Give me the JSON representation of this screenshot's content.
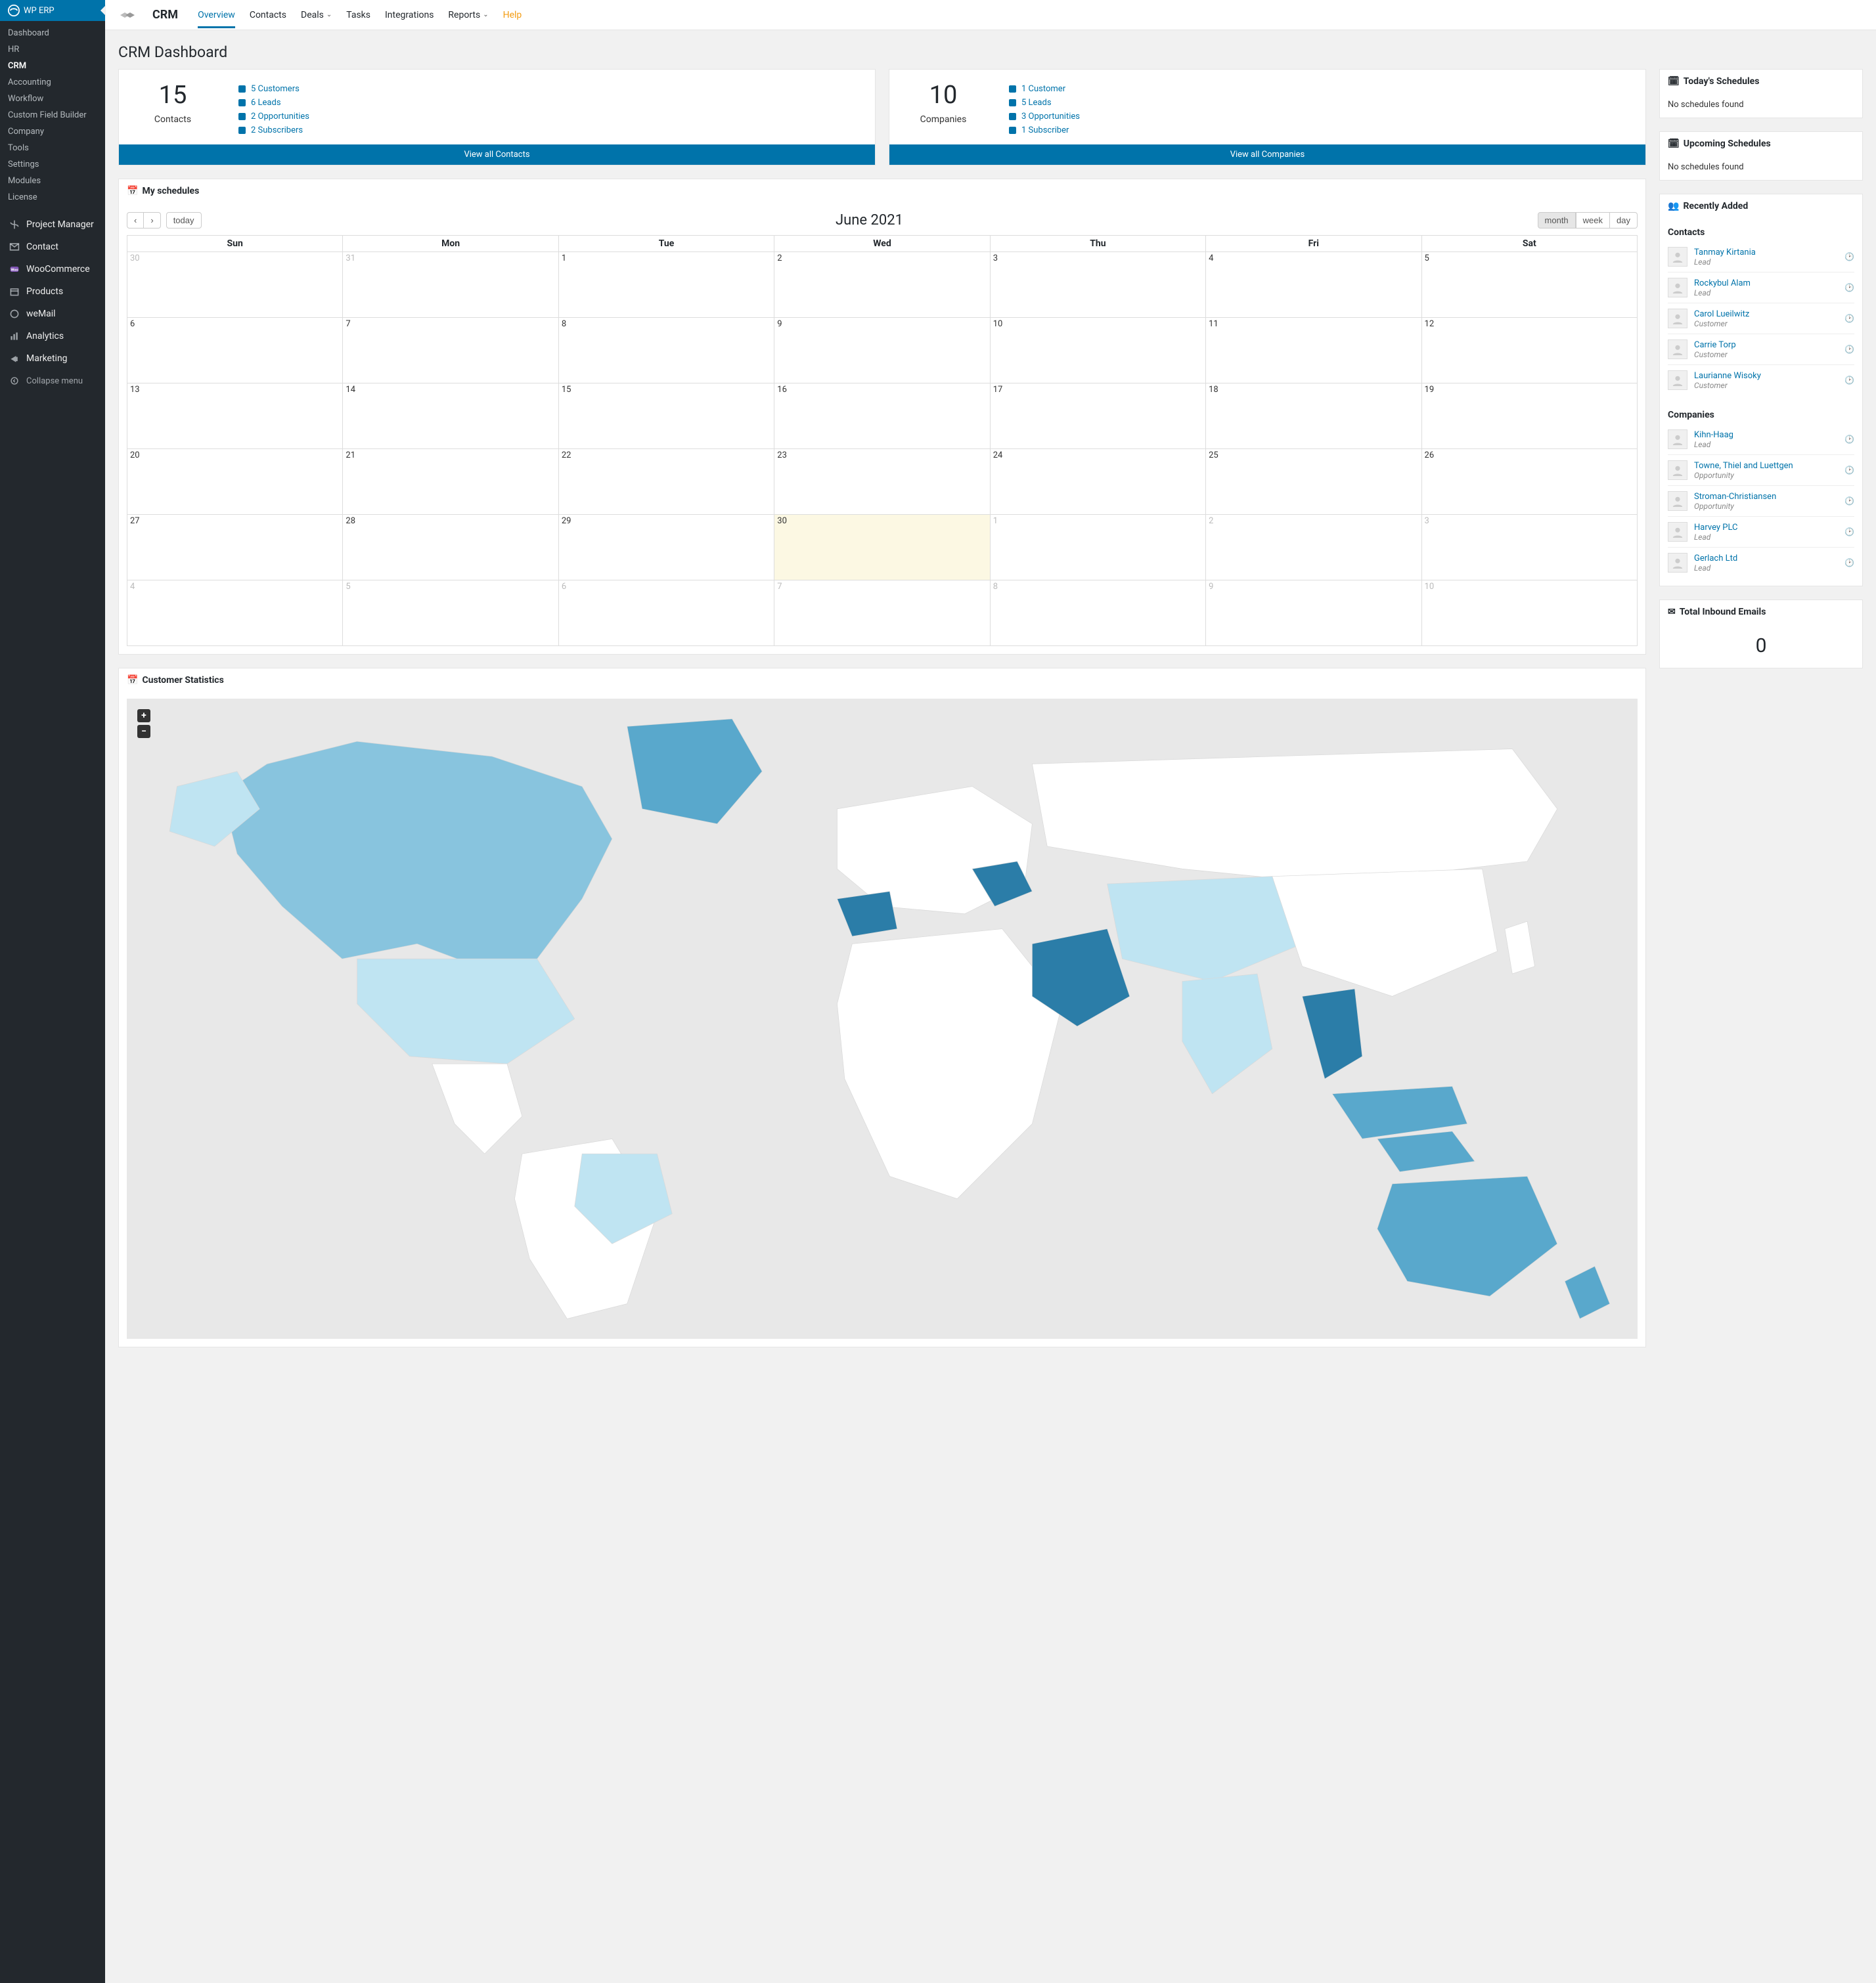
{
  "brand": "WP ERP",
  "admin_submenu": [
    {
      "label": "Dashboard",
      "active": false
    },
    {
      "label": "HR",
      "active": false
    },
    {
      "label": "CRM",
      "active": true
    },
    {
      "label": "Accounting",
      "active": false
    },
    {
      "label": "Workflow",
      "active": false
    },
    {
      "label": "Custom Field Builder",
      "active": false
    },
    {
      "label": "Company",
      "active": false
    },
    {
      "label": "Tools",
      "active": false
    },
    {
      "label": "Settings",
      "active": false
    },
    {
      "label": "Modules",
      "active": false
    },
    {
      "label": "License",
      "active": false
    }
  ],
  "admin_menu": [
    {
      "label": "Project Manager",
      "icon": "pm"
    },
    {
      "label": "Contact",
      "icon": "mail"
    },
    {
      "label": "WooCommerce",
      "icon": "woo"
    },
    {
      "label": "Products",
      "icon": "box"
    },
    {
      "label": "weMail",
      "icon": "wemail"
    },
    {
      "label": "Analytics",
      "icon": "bar"
    },
    {
      "label": "Marketing",
      "icon": "mega"
    }
  ],
  "collapse_label": "Collapse menu",
  "app_name": "CRM",
  "tabs": [
    {
      "label": "Overview",
      "active": true,
      "caret": false
    },
    {
      "label": "Contacts",
      "active": false,
      "caret": false
    },
    {
      "label": "Deals",
      "active": false,
      "caret": true
    },
    {
      "label": "Tasks",
      "active": false,
      "caret": false
    },
    {
      "label": "Integrations",
      "active": false,
      "caret": false
    },
    {
      "label": "Reports",
      "active": false,
      "caret": true
    },
    {
      "label": "Help",
      "active": false,
      "caret": false,
      "help": true
    }
  ],
  "page_title": "CRM Dashboard",
  "contacts_card": {
    "count": "15",
    "label": "Contacts",
    "items": [
      "5 Customers",
      "6 Leads",
      "2 Opportunities",
      "2 Subscribers"
    ],
    "footer": "View all Contacts"
  },
  "companies_card": {
    "count": "10",
    "label": "Companies",
    "items": [
      "1 Customer",
      "5 Leads",
      "3 Opportunities",
      "1 Subscriber"
    ],
    "footer": "View all Companies"
  },
  "schedules_title": "My schedules",
  "calendar": {
    "title": "June 2021",
    "today_btn": "today",
    "views": [
      {
        "l": "month",
        "a": true
      },
      {
        "l": "week",
        "a": false
      },
      {
        "l": "day",
        "a": false
      }
    ],
    "dow": [
      "Sun",
      "Mon",
      "Tue",
      "Wed",
      "Thu",
      "Fri",
      "Sat"
    ],
    "weeks": [
      [
        {
          "d": "30",
          "o": true
        },
        {
          "d": "31",
          "o": true
        },
        {
          "d": "1"
        },
        {
          "d": "2"
        },
        {
          "d": "3"
        },
        {
          "d": "4"
        },
        {
          "d": "5"
        }
      ],
      [
        {
          "d": "6"
        },
        {
          "d": "7"
        },
        {
          "d": "8"
        },
        {
          "d": "9"
        },
        {
          "d": "10"
        },
        {
          "d": "11"
        },
        {
          "d": "12"
        }
      ],
      [
        {
          "d": "13"
        },
        {
          "d": "14"
        },
        {
          "d": "15"
        },
        {
          "d": "16"
        },
        {
          "d": "17"
        },
        {
          "d": "18"
        },
        {
          "d": "19"
        }
      ],
      [
        {
          "d": "20"
        },
        {
          "d": "21"
        },
        {
          "d": "22"
        },
        {
          "d": "23"
        },
        {
          "d": "24"
        },
        {
          "d": "25"
        },
        {
          "d": "26"
        }
      ],
      [
        {
          "d": "27"
        },
        {
          "d": "28"
        },
        {
          "d": "29"
        },
        {
          "d": "30",
          "t": true
        },
        {
          "d": "1",
          "o": true
        },
        {
          "d": "2",
          "o": true
        },
        {
          "d": "3",
          "o": true
        }
      ],
      [
        {
          "d": "4",
          "o": true
        },
        {
          "d": "5",
          "o": true
        },
        {
          "d": "6",
          "o": true
        },
        {
          "d": "7",
          "o": true
        },
        {
          "d": "8",
          "o": true
        },
        {
          "d": "9",
          "o": true
        },
        {
          "d": "10",
          "o": true
        }
      ]
    ]
  },
  "cust_stats_title": "Customer Statistics",
  "side": {
    "today_title": "Today's Schedules",
    "today_body": "No schedules found",
    "upcoming_title": "Upcoming Schedules",
    "upcoming_body": "No schedules found",
    "recent_title": "Recently Added",
    "recent_contacts_title": "Contacts",
    "recent_contacts": [
      {
        "name": "Tanmay Kirtania",
        "type": "Lead"
      },
      {
        "name": "Rockybul Alam",
        "type": "Lead"
      },
      {
        "name": "Carol Lueilwitz",
        "type": "Customer"
      },
      {
        "name": "Carrie Torp",
        "type": "Customer"
      },
      {
        "name": "Laurianne Wisoky",
        "type": "Customer"
      }
    ],
    "recent_companies_title": "Companies",
    "recent_companies": [
      {
        "name": "Kihn-Haag",
        "type": "Lead"
      },
      {
        "name": "Towne, Thiel and Luettgen",
        "type": "Opportunity"
      },
      {
        "name": "Stroman-Christiansen",
        "type": "Opportunity"
      },
      {
        "name": "Harvey PLC",
        "type": "Lead"
      },
      {
        "name": "Gerlach Ltd",
        "type": "Lead"
      }
    ],
    "inbound_title": "Total Inbound Emails",
    "inbound_count": "0"
  }
}
